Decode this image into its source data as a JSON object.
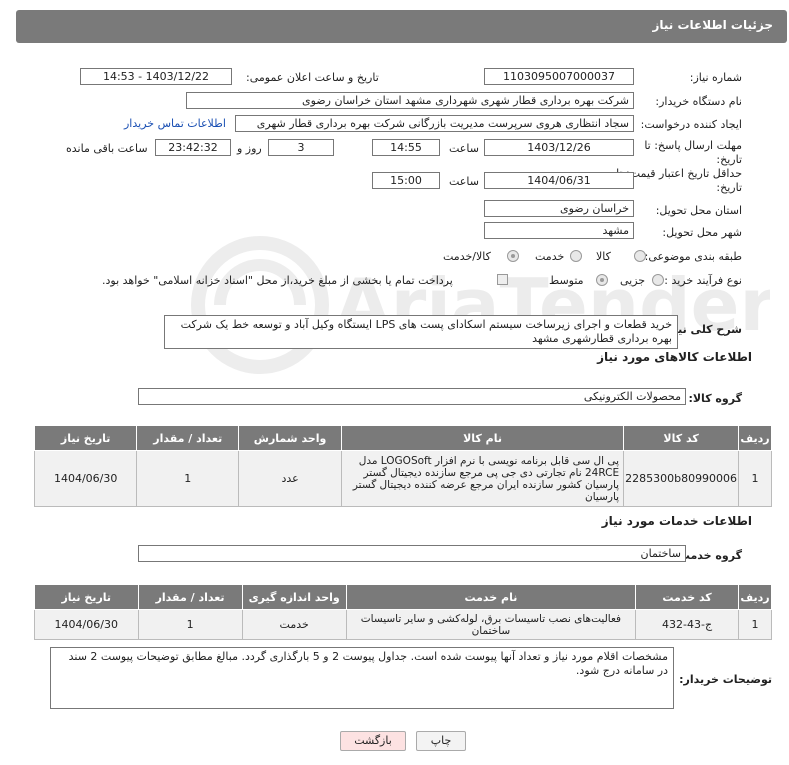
{
  "header": {
    "title": "جزئیات اطلاعات نیاز"
  },
  "fields": {
    "need_number_label": "شماره نیاز:",
    "need_number": "1103095007000037",
    "announce_label": "تاریخ و ساعت اعلان عمومی:",
    "announce_value": "1403/12/22 - 14:53",
    "buyer_org_label": "نام دستگاه خریدار:",
    "buyer_org": "شرکت بهره برداری قطار شهری شهرداری مشهد استان خراسان رضوی",
    "creator_label": "ایجاد کننده درخواست:",
    "creator": "سجاد انتظاری هروی سرپرست مدیریت بازرگانی شرکت بهره برداری قطار شهری",
    "contact_link": "اطلاعات تماس خریدار",
    "deadline_label_1": "مهلت ارسال پاسخ: تا",
    "deadline_label_2": "تاریخ:",
    "deadline_date": "1403/12/26",
    "time_label": "ساعت",
    "deadline_time": "14:55",
    "days_value": "3",
    "days_label": "روز و",
    "remaining_time": "23:42:32",
    "remaining_label": "ساعت باقی مانده",
    "validity_label_1": "حداقل تاریخ اعتبار قیمت: تا",
    "validity_label_2": "تاریخ:",
    "validity_date": "1404/06/31",
    "validity_time": "15:00",
    "province_label": "استان محل تحویل:",
    "province": "خراسان رضوی",
    "city_label": "شهر محل تحویل:",
    "city": "مشهد",
    "category_label": "طبقه بندی موضوعی:",
    "category_options": [
      "کالا",
      "خدمت",
      "کالا/خدمت"
    ],
    "category_selected": "کالا/خدمت",
    "process_label": "نوع فرآیند خرید :",
    "process_options": [
      "جزیی",
      "متوسط"
    ],
    "process_selected": "متوسط",
    "payment_note": "پرداخت تمام یا بخشی از مبلغ خرید،از محل \"اسناد خزانه اسلامی\" خواهد بود.",
    "description_label": "شرح کلی نیاز:",
    "description": "خرید قطعات و اجرای زیرساخت سیستم اسکادای پست های  LPS ایستگاه وکیل آباد و توسعه خط یک شرکت بهره برداری قطارشهری مشهد"
  },
  "goods": {
    "section_title": "اطلاعات کالاهای مورد نیاز",
    "group_label": "گروه کالا:",
    "group_value": "محصولات الکترونیکی",
    "columns": [
      "ردیف",
      "کد کالا",
      "نام کالا",
      "واحد شمارش",
      "تعداد / مقدار",
      "تاریخ نیاز"
    ],
    "rows": [
      {
        "row": "1",
        "code": "2285300b80990006",
        "name": "پی ال سی قابل برنامه نویسی با نرم افزار LOGOSoft مدل 24RCE نام تجارتی دی جی پی مرجع سازنده دیجیتال گستر پارسیان کشور سازنده ایران مرجع عرضه کننده دیجیتال گستر پارسیان",
        "unit": "عدد",
        "qty": "1",
        "date": "1404/06/30"
      }
    ]
  },
  "services": {
    "section_title": "اطلاعات خدمات مورد نیاز",
    "group_label": "گروه خدمت:",
    "group_value": "ساختمان",
    "columns": [
      "ردیف",
      "کد خدمت",
      "نام خدمت",
      "واحد اندازه گیری",
      "تعداد / مقدار",
      "تاریخ نیاز"
    ],
    "rows": [
      {
        "row": "1",
        "code": "ج-43-432",
        "name": "فعالیت‌های نصب تاسیسات برق، لوله‌کشی و سایر تاسیسات ساختمان",
        "unit": "خدمت",
        "qty": "1",
        "date": "1404/06/30"
      }
    ]
  },
  "buyer_notes": {
    "label": "توضیحات خریدار:",
    "text": "مشخصات اقلام مورد نیاز و تعداد آنها پیوست شده است. جداول پیوست 2 و 5 بارگذاری گردد. مبالغ مطابق توضیحات پیوست 2 سند در سامانه درج شود."
  },
  "buttons": {
    "print": "چاپ",
    "back": "بازگشت"
  },
  "watermark": "AriaTender.neT",
  "colors": {
    "header": "#7a7a7a",
    "link": "#1a4fb3",
    "back_button": "#fde2e2"
  }
}
